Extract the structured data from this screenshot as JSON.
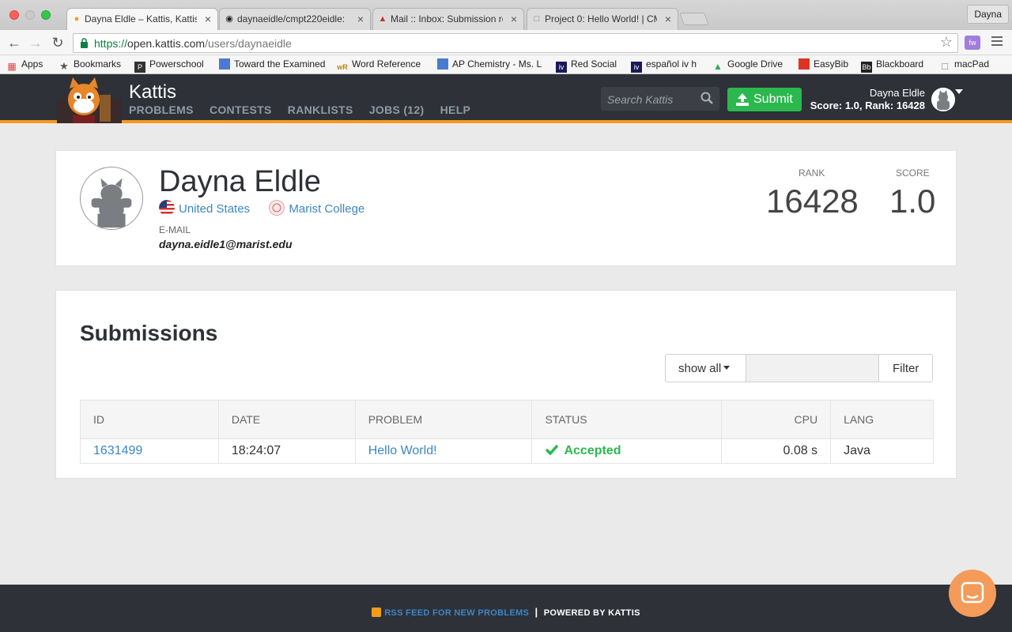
{
  "browser": {
    "tabs": [
      {
        "label": "Dayna Eldle – Kattis, Kattis",
        "active": true
      },
      {
        "label": "daynaeidle/cmpt220eidle: ",
        "active": false
      },
      {
        "label": "Mail :: Inbox: Submission re",
        "active": false
      },
      {
        "label": "Project 0: Hello World! | CM",
        "active": false
      }
    ],
    "profile_name": "Dayna",
    "url_protocol": "https://",
    "url_host": "open.kattis.com",
    "url_path": "/users/daynaeidle",
    "ext_label": "fw"
  },
  "bookmarks": [
    {
      "label": "Apps"
    },
    {
      "label": "Bookmarks"
    },
    {
      "label": "Powerschool"
    },
    {
      "label": "Toward the Examined"
    },
    {
      "label": "Word Reference"
    },
    {
      "label": "AP Chemistry - Ms. L"
    },
    {
      "label": "Red Social"
    },
    {
      "label": "español iv h"
    },
    {
      "label": "Google Drive"
    },
    {
      "label": "EasyBib"
    },
    {
      "label": "Blackboard"
    },
    {
      "label": "macPad"
    }
  ],
  "header": {
    "brand": "Kattis",
    "nav": [
      "PROBLEMS",
      "CONTESTS",
      "RANKLISTS",
      "JOBS (12)",
      "HELP"
    ],
    "search_placeholder": "Search Kattis",
    "submit_label": "Submit",
    "user_name": "Dayna Eldle",
    "user_score": "Score: 1.0, Rank: 16428"
  },
  "profile": {
    "name": "Dayna Eldle",
    "country": "United States",
    "school": "Marist College",
    "email_label": "E-MAIL",
    "email": "dayna.eidle1@marist.edu",
    "rank_label": "RANK",
    "rank": "16428",
    "score_label": "SCORE",
    "score": "1.0"
  },
  "submissions": {
    "title": "Submissions",
    "show_all_label": "show all",
    "filter_label": "Filter",
    "columns": [
      "ID",
      "DATE",
      "PROBLEM",
      "STATUS",
      "CPU",
      "LANG"
    ],
    "rows": [
      {
        "id": "1631499",
        "date": "18:24:07",
        "problem": "Hello World!",
        "status": "Accepted",
        "cpu": "0.08 s",
        "lang": "Java"
      }
    ]
  },
  "footer": {
    "rss_label": "RSS FEED FOR NEW PROBLEMS",
    "separator": "|",
    "powered": "POWERED BY KATTIS"
  },
  "colors": {
    "header_bg": "#2e3138",
    "accent_orange": "#f49b1c",
    "submit_green": "#2bb84e",
    "link_blue": "#3b86c6"
  }
}
